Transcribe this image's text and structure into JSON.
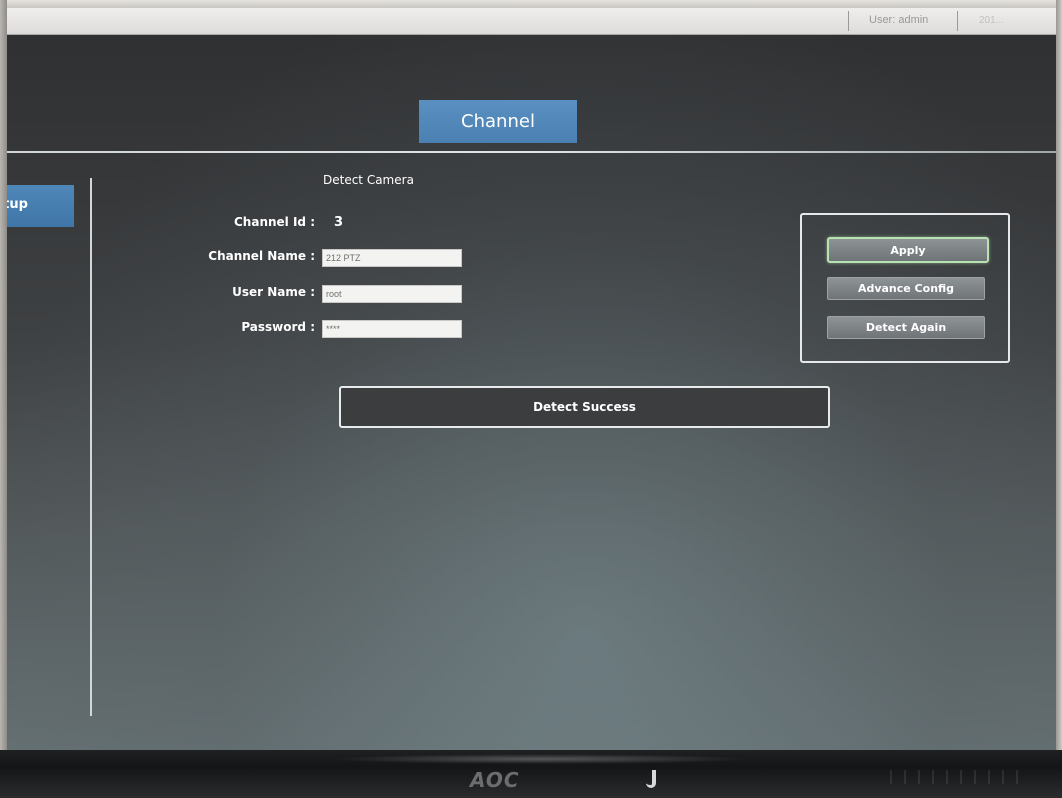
{
  "topbar": {
    "user": "User: admin",
    "date": "201..."
  },
  "header": {
    "tab": "Channel"
  },
  "sidebar": {
    "active_item": "Setup"
  },
  "form": {
    "title": "Detect Camera",
    "channel_id_label": "Channel Id :",
    "channel_id_value": "3",
    "channel_name_label": "Channel Name :",
    "channel_name_value": "212 PTZ",
    "user_name_label": "User Name :",
    "user_name_value": "root",
    "password_label": "Password :",
    "password_value": "****"
  },
  "actions": {
    "apply": "Apply",
    "advance_config": "Advance Config",
    "detect_again": "Detect Again"
  },
  "status": {
    "message": "Detect Success"
  },
  "monitor": {
    "brand": "AOC"
  },
  "colors": {
    "accent_blue": "#5a90c1",
    "screen_dark": "#36383a",
    "apply_highlight": "#b9e2b2"
  }
}
